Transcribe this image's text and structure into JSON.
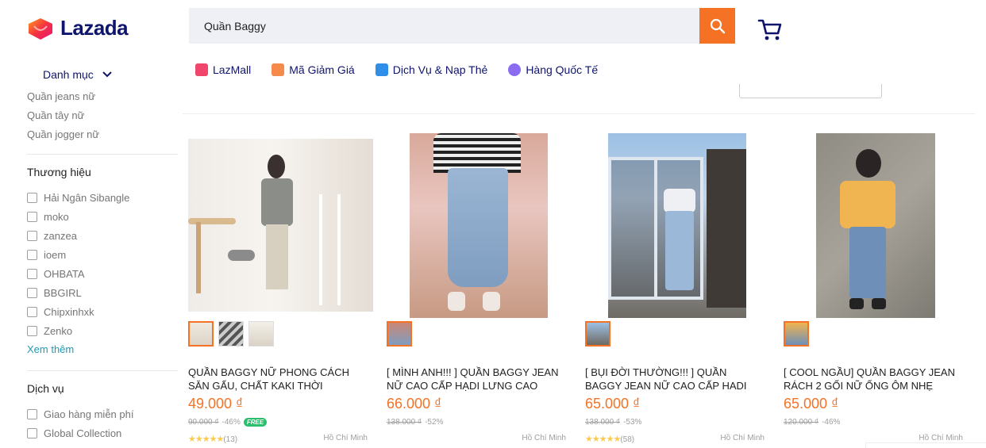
{
  "logo": {
    "text": "Lazada"
  },
  "search": {
    "value": "Quần Baggy"
  },
  "nav": [
    {
      "label": "LazMall",
      "color": "#f0466b"
    },
    {
      "label": "Mã Giảm Giá",
      "color": "#f58a4b"
    },
    {
      "label": "Dịch Vụ & Nạp Thẻ",
      "color": "#2f8fe8"
    },
    {
      "label": "Hàng Quốc Tế",
      "color": "#8a6cf0"
    }
  ],
  "sidebar": {
    "category_toggle": "Danh mục",
    "categories": [
      "Quần jeans nữ",
      "Quần tây nữ",
      "Quần jogger nữ"
    ],
    "brand_heading": "Thương hiệu",
    "brands": [
      "Hải Ngân Sibangle",
      "moko",
      "zanzea",
      "ioem",
      "OHBATA",
      "BBGIRL",
      "Chipxinhxk",
      "Zenko"
    ],
    "more": "Xem thêm",
    "service_heading": "Dịch vụ",
    "services": [
      "Giao hàng miễn phí",
      "Global Collection"
    ]
  },
  "products": [
    {
      "title": "QUẦN BAGGY NỮ PHONG CÁCH SĂN GẤU, CHẤT KAKI THỜI TRANG...",
      "price": "49.000 ₫",
      "original": "90.000 ₫",
      "discount": "-46%",
      "free_badge": "FREE",
      "stars": "★★★★★",
      "reviews": "(13)",
      "location": "Hồ Chí Minh"
    },
    {
      "title": "[ MÌNH ANH!!! ] QUẦN BAGGY JEAN NỮ CAO CẤP HẠDI LƯNG CAO MÀU...",
      "price": "66.000 ₫",
      "original": "138.000 ₫",
      "discount": "-52%",
      "stars": "",
      "reviews": "",
      "location": "Hồ Chí Minh"
    },
    {
      "title": "[ BỤI ĐỜI THƯỜNG!!! ] QUẦN BAGGY JEAN NỮ CAO CẤP HADI LƯNG SIÊ...",
      "price": "65.000 ₫",
      "original": "138.000 ₫",
      "discount": "-53%",
      "stars": "★★★★★",
      "reviews": "(58)",
      "location": "Hồ Chí Minh"
    },
    {
      "title": "[ COOL NGẦU] QUẦN BAGGY JEAN RÁCH 2 GỐI NỮ ỐNG ÔM NHẸ CHẤ...",
      "price": "65.000 ₫",
      "original": "120.000 ₫",
      "discount": "-46%",
      "stars": "",
      "reviews": "",
      "location": "Hồ Chí Minh"
    }
  ],
  "colors": {
    "accent": "#f57224",
    "brand": "#0f146d",
    "link": "#1a9cb7",
    "star": "#faca51"
  }
}
